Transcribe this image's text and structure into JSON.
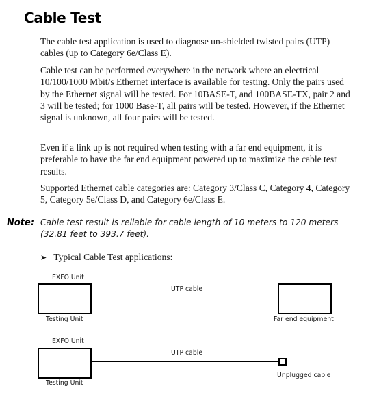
{
  "document": {
    "title": "Cable Test",
    "paragraphs": [
      "The cable test application is used to diagnose un-shielded twisted pairs (UTP) cables (up to Category 6e/Class E).",
      "Cable test can be performed everywhere in the network where an electrical 10/100/1000 Mbit/s Ethernet interface is available for testing. Only the pairs used by the Ethernet signal will be tested. For 10BASE-T, and 100BASE-TX, pair 2 and 3 will be tested; for 1000 Base-T, all pairs will be tested. However, if the Ethernet signal is unknown, all four pairs will be tested.",
      "Even if a link up is not required when testing with a far end equipment, it is preferable to have the far end equipment powered up to maximize the cable test results.",
      "Supported Ethernet cable categories are: Category 3/Class C, Category 4, Category 5, Category 5e/Class D, and Category 6e/Class E."
    ],
    "note": {
      "label": "Note:",
      "text": "Cable test result is reliable for cable length of 10 meters to 120 meters (32.81 feet to 393.7 feet)."
    },
    "bullet": {
      "icon": "➤",
      "text": "Typical Cable Test applications:"
    }
  },
  "diagrams": [
    {
      "unit_top_label": "EXFO Unit",
      "unit_bottom_label": "Testing Unit",
      "cable_label": "UTP cable",
      "far_end_label": "Far end equipment"
    },
    {
      "unit_top_label": "EXFO Unit",
      "unit_bottom_label": "Testing Unit",
      "cable_label": "UTP cable",
      "far_end_label": "Unplugged cable"
    }
  ]
}
